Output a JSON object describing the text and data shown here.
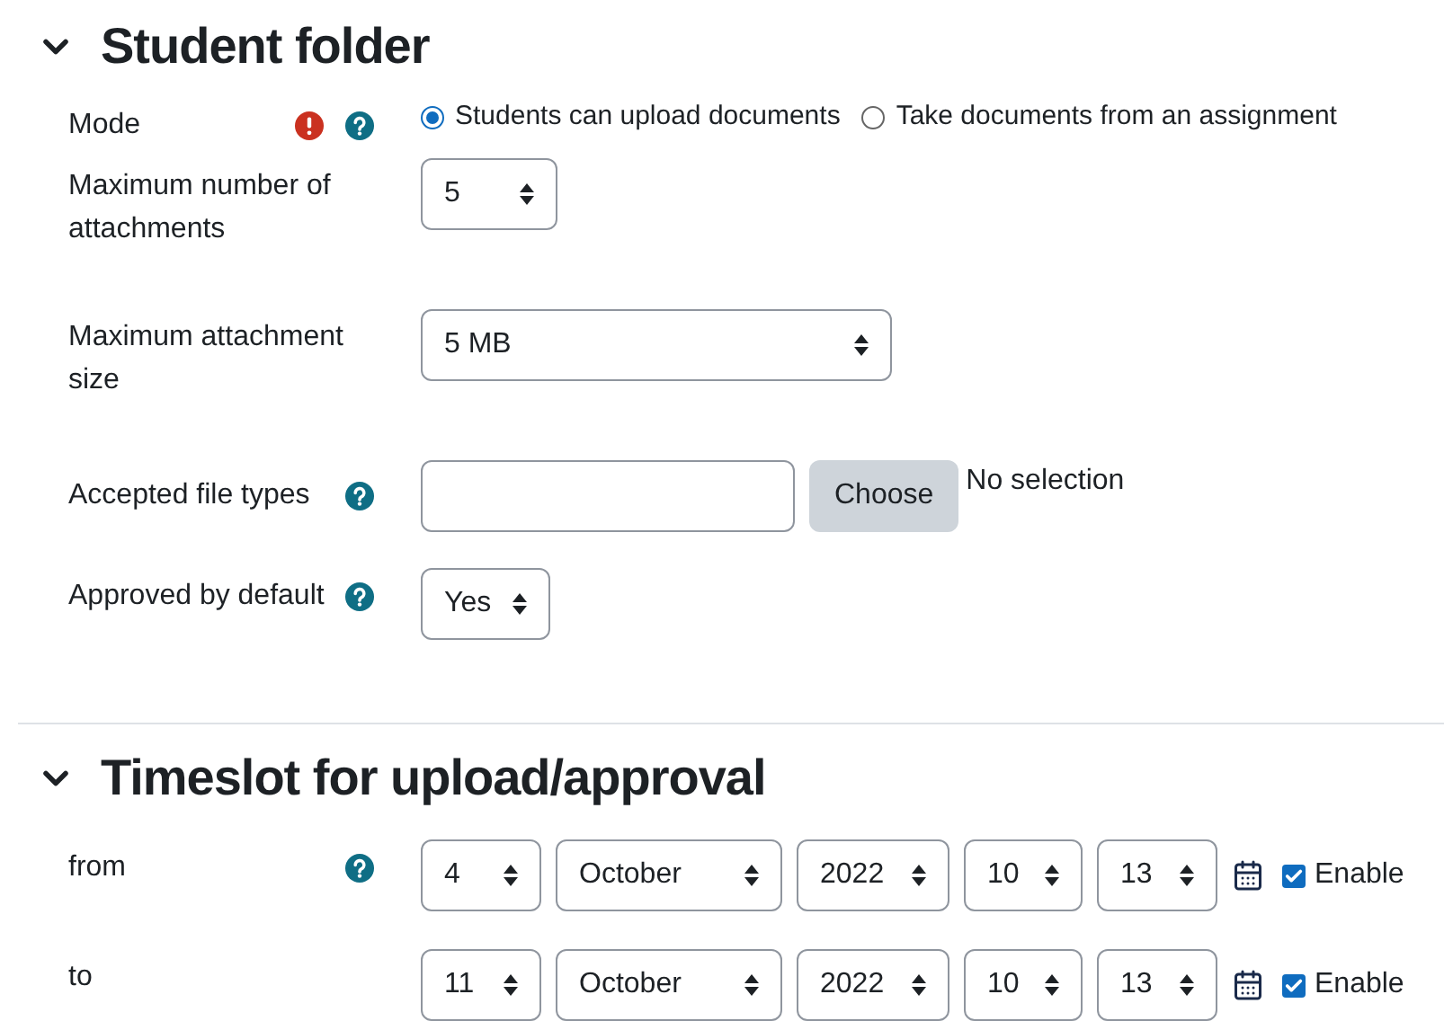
{
  "sections": [
    {
      "title": "Student folder",
      "expanded": true,
      "rows": [
        {
          "kind": "radio",
          "label": "Mode",
          "required": true,
          "help": true,
          "options": [
            {
              "label": "Students can upload documents",
              "selected": true
            },
            {
              "label": "Take documents from an assignment",
              "selected": false
            }
          ]
        },
        {
          "kind": "select",
          "label": "Maximum number of attachments",
          "help": false,
          "value": "5"
        },
        {
          "kind": "select",
          "label": "Maximum attachment size",
          "help": false,
          "value": "5 MB"
        },
        {
          "kind": "file",
          "label": "Accepted file types",
          "help": true,
          "button": "Choose",
          "status": "No selection"
        },
        {
          "kind": "select",
          "label": "Approved by default",
          "help": true,
          "value": "Yes"
        }
      ]
    },
    {
      "title": "Timeslot for upload/approval",
      "expanded": true,
      "rows": [
        {
          "kind": "datetime",
          "label": "from",
          "help": true,
          "day": "4",
          "month": "October",
          "year": "2022",
          "hour": "10",
          "minute": "13",
          "enable_label": "Enable",
          "enabled": true
        },
        {
          "kind": "datetime",
          "label": "to",
          "help": false,
          "day": "11",
          "month": "October",
          "year": "2022",
          "hour": "10",
          "minute": "13",
          "enable_label": "Enable",
          "enabled": true
        }
      ]
    }
  ]
}
